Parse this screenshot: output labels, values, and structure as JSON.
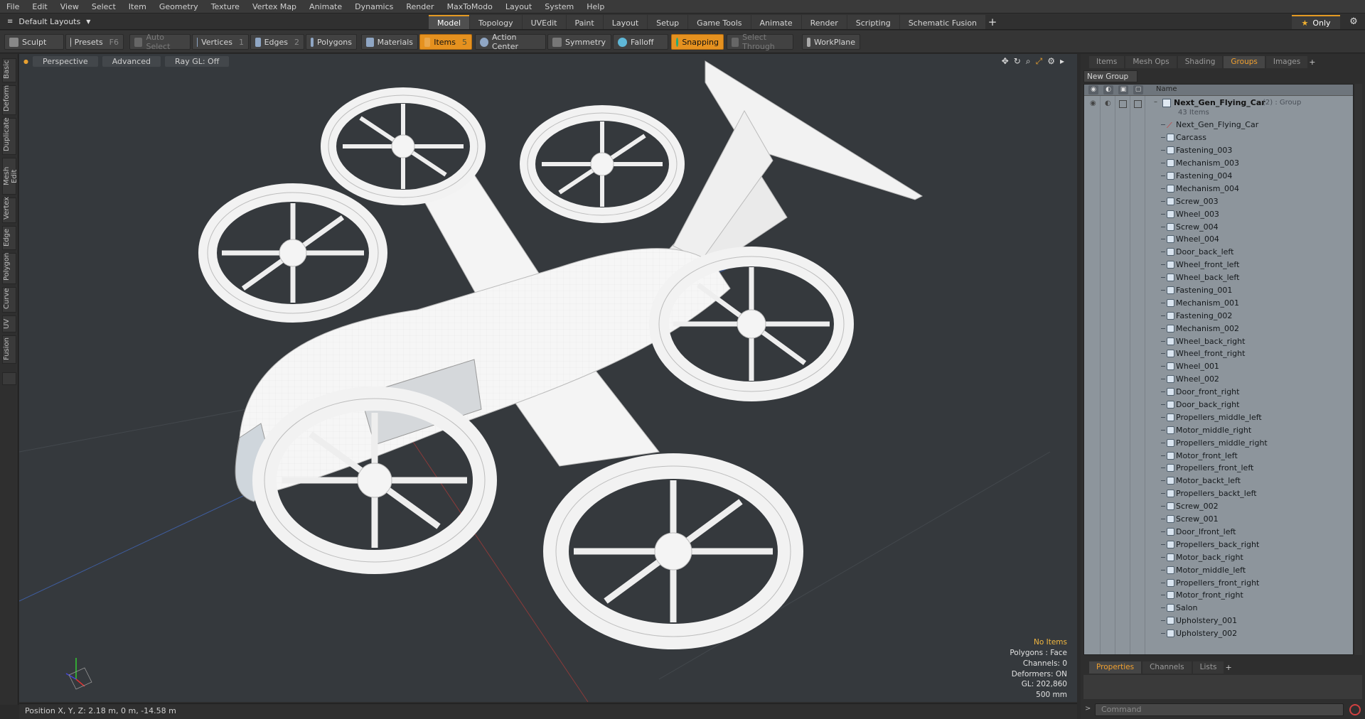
{
  "menu": [
    "File",
    "Edit",
    "View",
    "Select",
    "Item",
    "Geometry",
    "Texture",
    "Vertex Map",
    "Animate",
    "Dynamics",
    "Render",
    "MaxToModo",
    "Layout",
    "System",
    "Help"
  ],
  "layout_selector": "Default Layouts",
  "mode_tabs": [
    "Model",
    "Topology",
    "UVEdit",
    "Paint",
    "Layout",
    "Setup",
    "Game Tools",
    "Animate",
    "Render",
    "Scripting",
    "Schematic Fusion"
  ],
  "active_tab": "Model",
  "only_label": "Only",
  "toolbar": {
    "sculpt": "Sculpt",
    "presets": "Presets",
    "presets_key": "F6",
    "auto_select": "Auto Select",
    "vertices": "Vertices",
    "vertices_n": "1",
    "edges": "Edges",
    "edges_n": "2",
    "polygons": "Polygons",
    "materials": "Materials",
    "items": "Items",
    "items_n": "5",
    "action_center": "Action Center",
    "symmetry": "Symmetry",
    "falloff": "Falloff",
    "snapping": "Snapping",
    "select_through": "Select Through",
    "workplane": "WorkPlane"
  },
  "left_tabs": [
    "Basic",
    "Deform",
    "Duplicate",
    "Mesh Edit",
    "Vertex",
    "Edge",
    "Polygon",
    "Curve",
    "UV",
    "Fusion"
  ],
  "viewport": {
    "view": "Perspective",
    "shading": "Advanced",
    "raygl": "Ray GL: Off"
  },
  "hud": {
    "no_items": "No Items",
    "polygons": "Polygons : Face",
    "channels": "Channels: 0",
    "deformers": "Deformers: ON",
    "gl": "GL: 202,860",
    "scale": "500 mm"
  },
  "status": "Position X, Y, Z:  2.18 m, 0 m, -14.58 m",
  "right_tabs": [
    "Items",
    "Mesh Ops",
    "Shading",
    "Groups",
    "Images"
  ],
  "active_right_tab": "Groups",
  "new_group": "New Group",
  "name_col": "Name",
  "group": {
    "name": "Next_Gen_Flying_Car",
    "suffix": "(2) : Group",
    "count": "43 Items"
  },
  "items": [
    "Next_Gen_Flying_Car",
    "Carcass",
    "Fastening_003",
    "Mechanism_003",
    "Fastening_004",
    "Mechanism_004",
    "Screw_003",
    "Wheel_003",
    "Screw_004",
    "Wheel_004",
    "Door_back_left",
    "Wheel_front_left",
    "Wheel_back_left",
    "Fastening_001",
    "Mechanism_001",
    "Fastening_002",
    "Mechanism_002",
    "Wheel_back_right",
    "Wheel_front_right",
    "Wheel_001",
    "Wheel_002",
    "Door_front_right",
    "Door_back_right",
    "Propellers_middle_left",
    "Motor_middle_right",
    "Propellers_middle_right",
    "Motor_front_left",
    "Propellers_front_left",
    "Motor_backt_left",
    "Propellers_backt_left",
    "Screw_002",
    "Screw_001",
    "Door_lfront_left",
    "Propellers_back_right",
    "Motor_back_right",
    "Motor_middle_left",
    "Propellers_front_right",
    "Motor_front_right",
    "Salon",
    "Upholstery_001",
    "Upholstery_002"
  ],
  "bottom_tabs": [
    "Properties",
    "Channels",
    "Lists"
  ],
  "command_placeholder": "Command"
}
